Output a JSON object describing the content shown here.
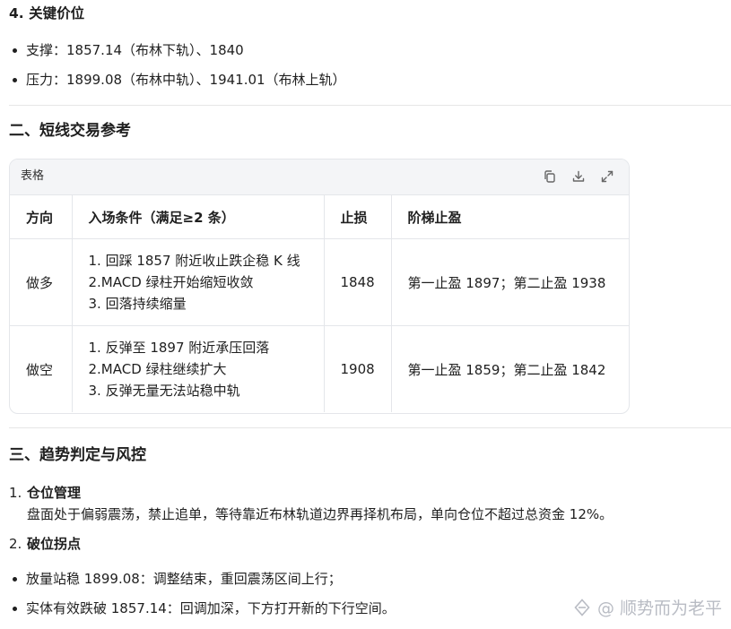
{
  "section4": {
    "title": "4. 关键价位",
    "bullets": [
      "支撑：1857.14（布林下轨）、1840",
      "压力：1899.08（布林中轨）、1941.01（布林上轨）"
    ]
  },
  "section2": {
    "title": "二、短线交易参考",
    "table": {
      "card_label": "表格",
      "toolbar_icons": [
        "copy-icon",
        "download-icon",
        "expand-icon"
      ],
      "headers": [
        "方向",
        "入场条件（满足≥2 条）",
        "止损",
        "阶梯止盈"
      ],
      "rows": [
        {
          "direction": "做多",
          "conditions": [
            "1. 回踩 1857 附近收止跌企稳 K 线",
            "2.MACD 绿柱开始缩短收敛",
            "3. 回落持续缩量"
          ],
          "stop": "1848",
          "target": "第一止盈 1897；第二止盈 1938"
        },
        {
          "direction": "做空",
          "conditions": [
            "1. 反弹至 1897 附近承压回落",
            "2.MACD 绿柱继续扩大",
            "3. 反弹无量无法站稳中轨"
          ],
          "stop": "1908",
          "target": "第一止盈 1859；第二止盈 1842"
        }
      ]
    }
  },
  "section3": {
    "title": "三、趋势判定与风控",
    "items": [
      {
        "num": "1.",
        "title": "仓位管理",
        "text": "盘面处于偏弱震荡，禁止追单，等待靠近布林轨道边界再择机布局，单向仓位不超过总资金 12%。"
      },
      {
        "num": "2.",
        "title": "破位拐点",
        "bullets": [
          "放量站稳 1899.08：调整结束，重回震荡区间上行；",
          "实体有效跌破 1857.14：回调加深，下方打开新的下行空间。"
        ]
      }
    ]
  },
  "watermark": {
    "icon": "logo-icon",
    "text": "@ 顺势而为老平"
  }
}
